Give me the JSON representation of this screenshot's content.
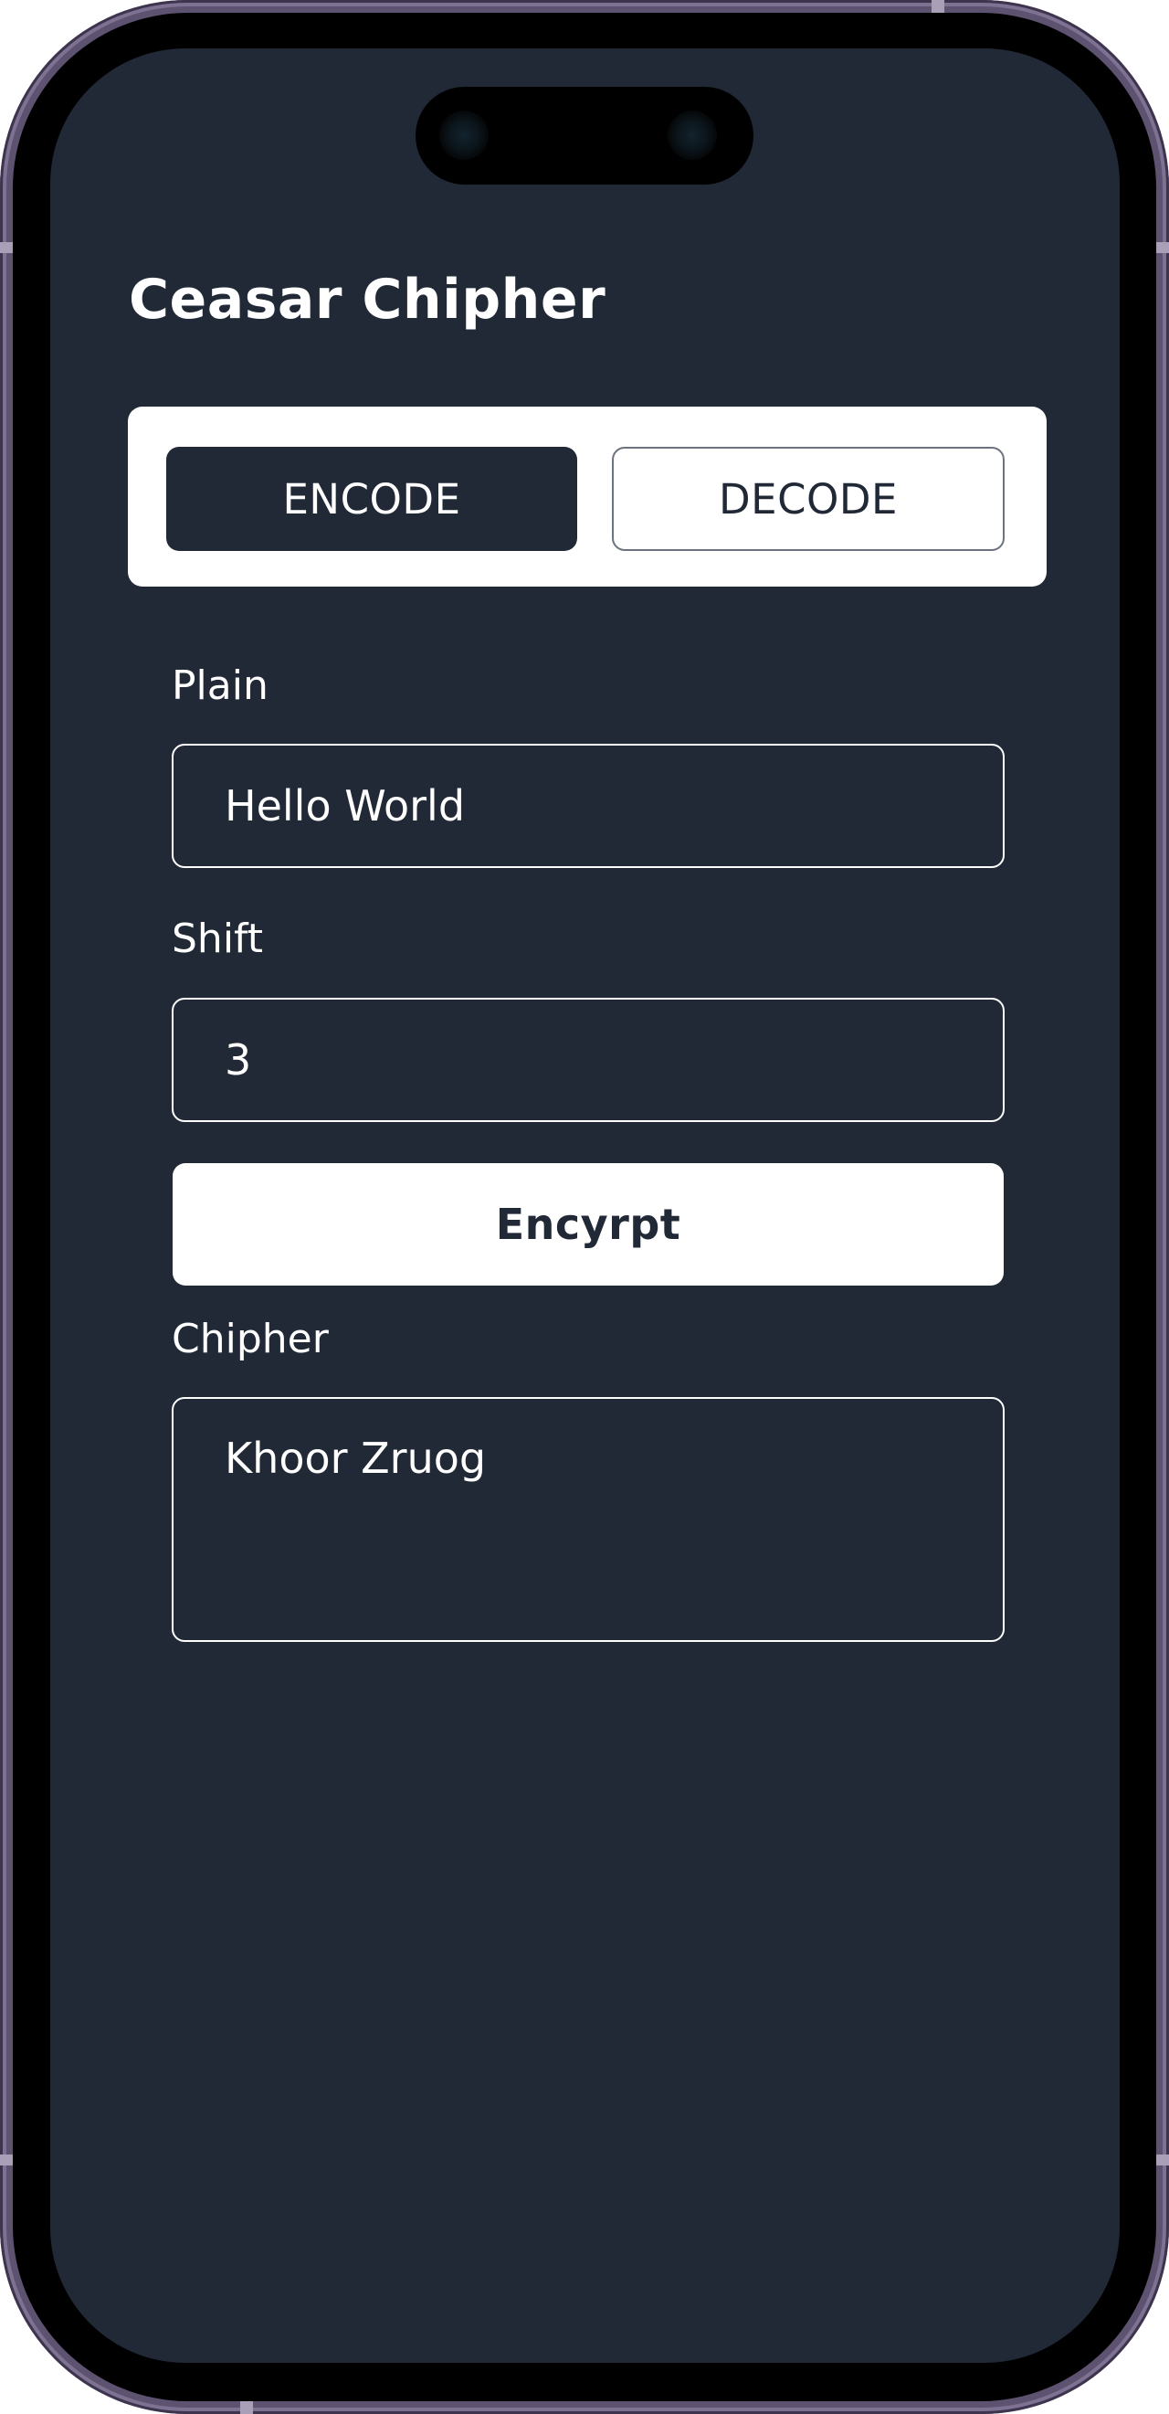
{
  "app": {
    "title": "Ceasar Chipher"
  },
  "mode_toggle": {
    "encode_label": "ENCODE",
    "decode_label": "DECODE",
    "selected": "ENCODE"
  },
  "form": {
    "plain_label": "Plain",
    "plain_value": "Hello World",
    "shift_label": "Shift",
    "shift_value": "3",
    "action_label": "Encyrpt",
    "cipher_label": "Chipher",
    "cipher_value": "Khoor Zruog"
  },
  "colors": {
    "background": "#212937",
    "surface": "#ffffff",
    "text_on_dark": "#ffffff",
    "text_on_light": "#212937",
    "phone_frame": "#5d5270"
  }
}
